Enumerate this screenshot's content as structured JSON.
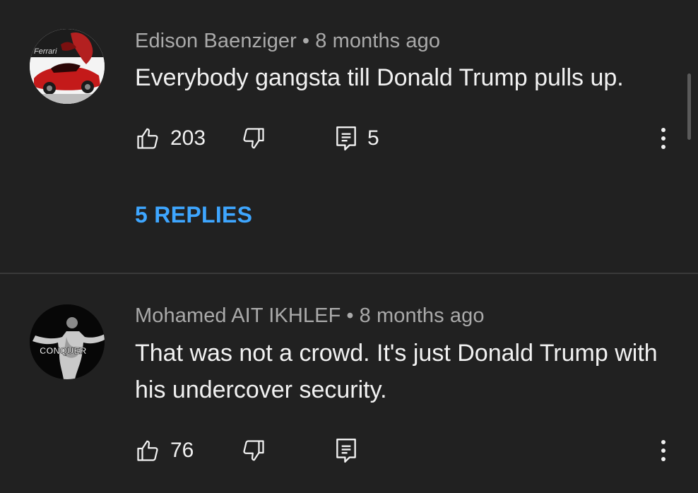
{
  "comments": [
    {
      "author": "Edison Baenziger",
      "separator": "•",
      "time": "8 months ago",
      "text": "Everybody gangsta till Donald Trump pulls up.",
      "likes": "203",
      "reply_count": "5",
      "replies_link": "5 REPLIES",
      "avatar_text": "Ferrari",
      "avatar_icon": "ferrari-car-avatar"
    },
    {
      "author": "Mohamed AIT IKHLEF",
      "separator": "•",
      "time": "8 months ago",
      "text": "That was not a crowd. It's just Donald Trump with his undercover security.",
      "likes": "76",
      "reply_count": "",
      "avatar_text": "CONQUER",
      "avatar_icon": "conquer-figure-avatar"
    }
  ],
  "icons": {
    "like": "thumbs-up-icon",
    "dislike": "thumbs-down-icon",
    "reply": "reply-comment-icon",
    "more": "more-vertical-icon"
  },
  "colors": {
    "background": "#212121",
    "text": "#f1f1f1",
    "meta": "#aaaaaa",
    "link": "#3ea6ff",
    "divider": "#3a3a3a"
  }
}
